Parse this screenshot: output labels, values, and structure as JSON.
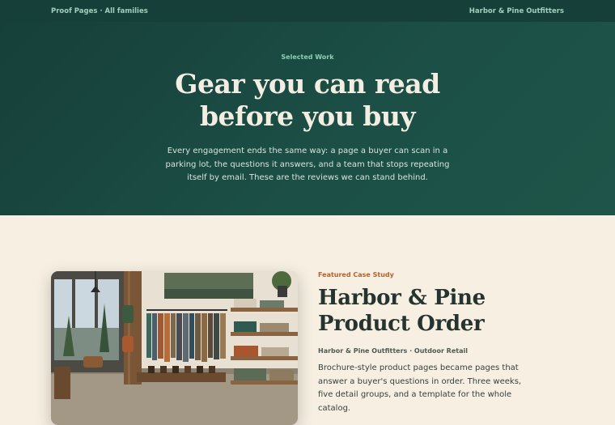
{
  "nav": {
    "left_link": "Proof Pages · All families",
    "right_link": "Harbor & Pine Outfitters"
  },
  "hero": {
    "eyebrow": "Selected Work",
    "title_line1": "Gear you can read",
    "title_line2": "before you buy",
    "description": "Every engagement ends the same way: a page a buyer can scan in a parking lot, the questions it answers, and a team that stops repeating itself by email. These are the reviews we can stand behind."
  },
  "featured": {
    "eyebrow": "Featured Case Study",
    "title_line1": "Harbor & Pine",
    "title_line2": "Product Order",
    "meta": "Harbor & Pine Outfitters · Outdoor Retail",
    "description": "Brochure-style product pages became pages that answer a buyer's questions in order. Three weeks, five detail groups, and a template for the whole catalog."
  },
  "colors": {
    "hero_bg": "#1c5047",
    "accent": "#b5612e",
    "page_bg": "#f6efe2"
  }
}
